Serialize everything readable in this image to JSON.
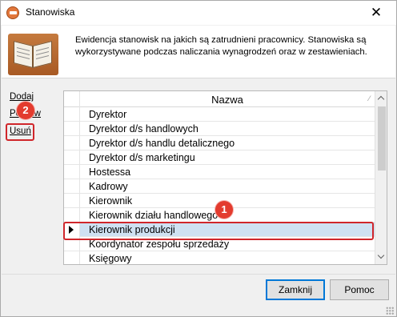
{
  "window": {
    "title": "Stanowiska",
    "close_glyph": "✕",
    "icon": "app-logo-icon"
  },
  "header": {
    "description": "Ewidencja stanowisk na jakich są zatrudnieni pracownicy. Stanowiska są wykorzystywane podczas naliczania wynagrodzeń oraz w zestawieniach.",
    "logo_icon": "open-book-icon"
  },
  "actions": {
    "add": "Dodaj",
    "edit": "Popraw",
    "delete": "Usuń"
  },
  "annotations": {
    "marker_1": "1",
    "marker_2": "2",
    "highlight_color": "#d0262b"
  },
  "grid": {
    "column_header": "Nazwa",
    "sort_glyph": "⁄",
    "selected_index": 8,
    "rows": [
      "Dyrektor",
      "Dyrektor d/s handlowych",
      "Dyrektor d/s handlu detalicznego",
      "Dyrektor d/s marketingu",
      "Hostessa",
      "Kadrowy",
      "Kierownik",
      "Kierownik działu handlowego",
      "Kierownik produkcji",
      "Koordynator zespołu sprzedaży",
      "Księgowy"
    ],
    "scroll_position": 0
  },
  "buttons": {
    "close": "Zamknij",
    "help": "Pomoc"
  },
  "colors": {
    "selection_row": "#cfe1f2",
    "default_button_border": "#0078d7",
    "marker_fill": "#e33b2e"
  }
}
